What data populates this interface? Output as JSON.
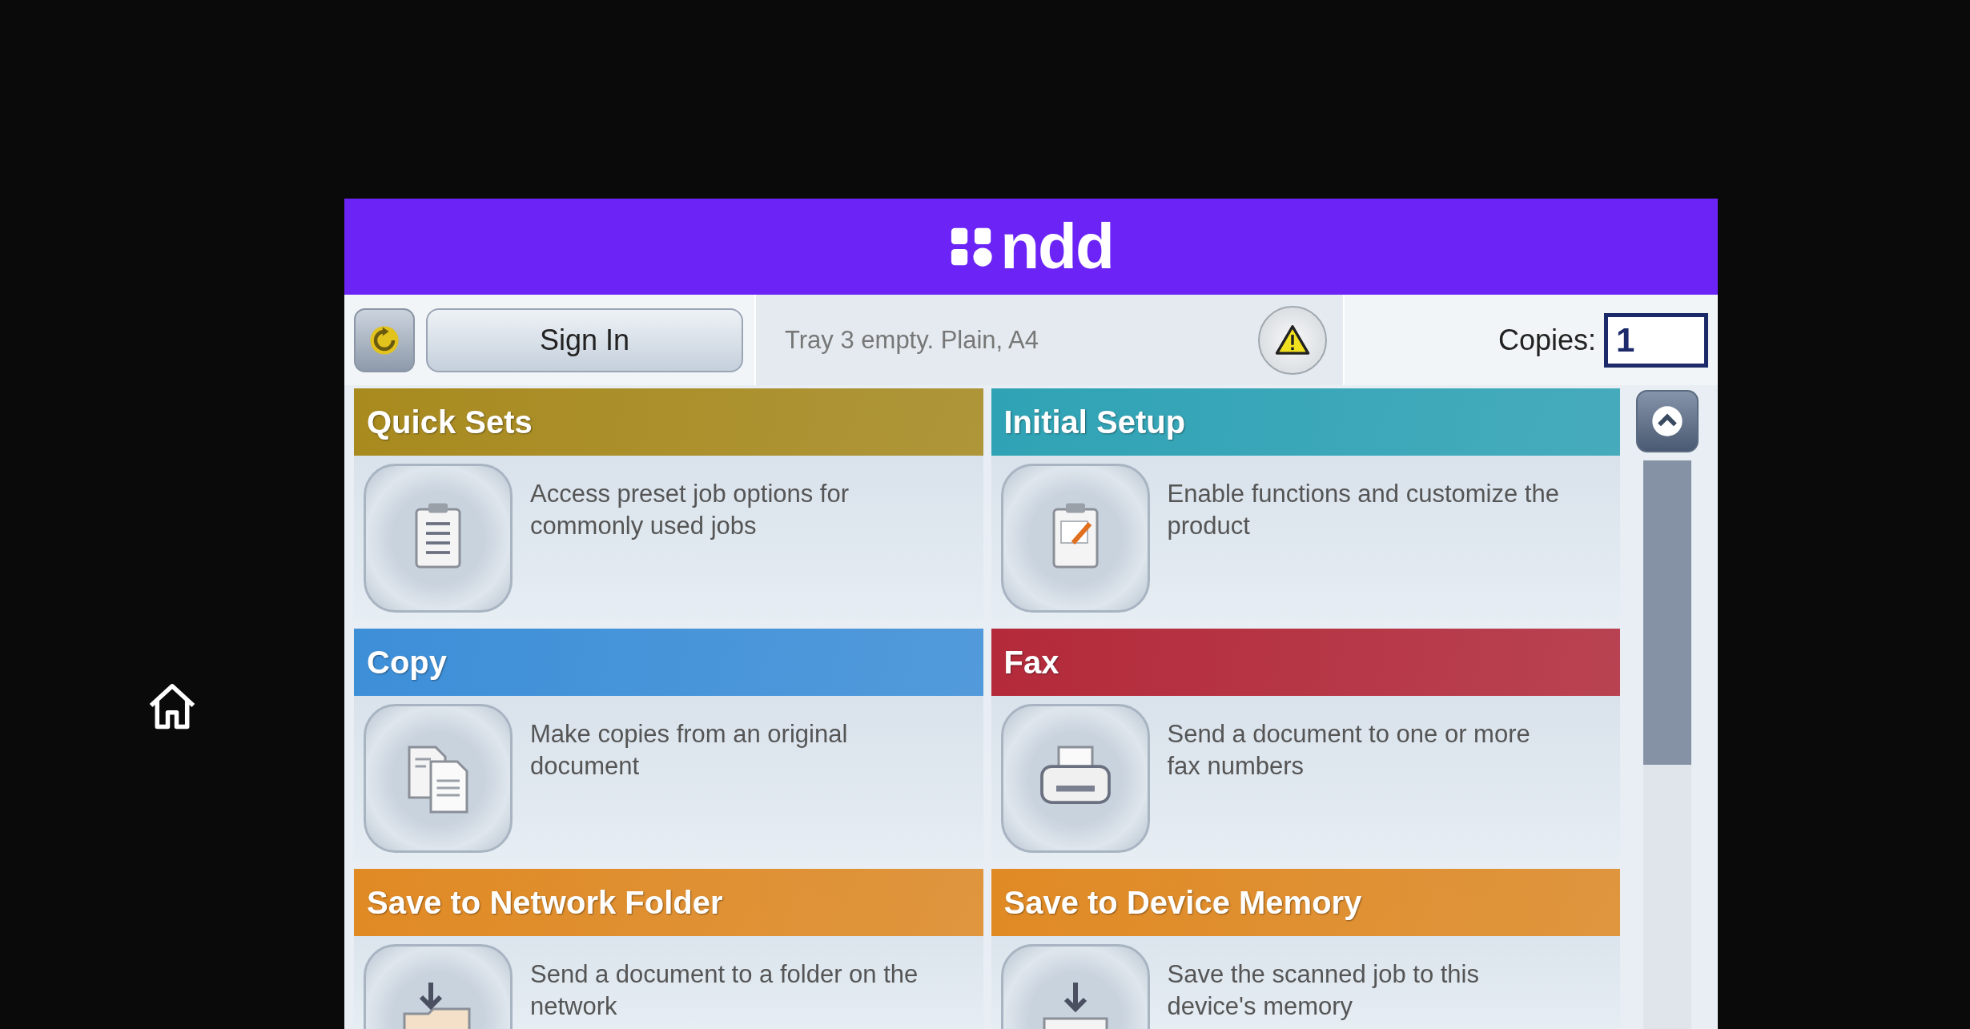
{
  "header": {
    "logo_text": "ndd"
  },
  "status_bar": {
    "sign_in": "Sign In",
    "message": "Tray 3 empty. Plain, A4",
    "copies_label": "Copies:",
    "copies_value": "1"
  },
  "tiles": [
    {
      "title": "Quick Sets",
      "description": "Access preset job options for commonly used jobs",
      "color": "#a88a1e",
      "kind": "checklist"
    },
    {
      "title": "Initial Setup",
      "description": "Enable functions and customize the product",
      "color": "#2fa3b5",
      "kind": "clipboard"
    },
    {
      "title": "Copy",
      "description": "Make copies from an original document",
      "color": "#3d8fd8",
      "kind": "copy"
    },
    {
      "title": "Fax",
      "description": "Send a document to one or more fax numbers",
      "color": "#b42a3a",
      "kind": "fax"
    },
    {
      "title": "Save to Network Folder",
      "description": "Send a document to a folder on the network",
      "color": "#e08a24",
      "kind": "folder"
    },
    {
      "title": "Save to Device Memory",
      "description": "Save the scanned job to this device's memory",
      "color": "#e08a24",
      "kind": "tray"
    }
  ]
}
